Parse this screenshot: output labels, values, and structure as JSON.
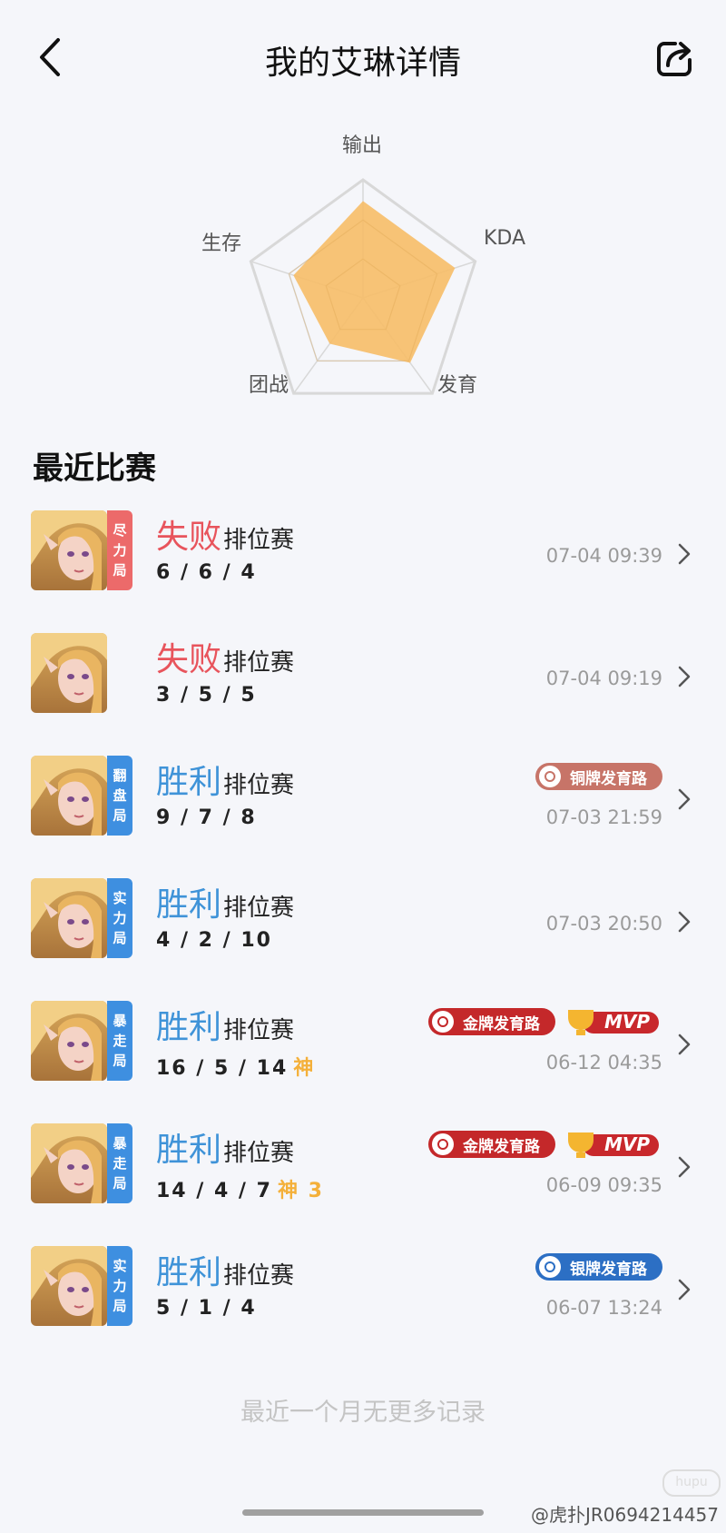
{
  "header": {
    "title": "我的艾琳详情"
  },
  "radar": {
    "labels": [
      "输出",
      "KDA",
      "发育",
      "团战",
      "生存"
    ],
    "values": [
      0.82,
      0.82,
      0.68,
      0.48,
      0.62
    ],
    "fill_color": "#f6be6a",
    "grid_color": "#d8d8d8"
  },
  "section_title": "最近比赛",
  "matches": [
    {
      "tag": "尽力局",
      "tag_color": "#ec6a6a",
      "result": "失败",
      "result_color": "#e8545c",
      "mode": "排位赛",
      "kda": "6 / 6 / 4",
      "extra": "",
      "time": "07-04 09:39",
      "badges": []
    },
    {
      "tag": "",
      "tag_color": "",
      "result": "失败",
      "result_color": "#e8545c",
      "mode": "排位赛",
      "kda": "3 / 5 / 5",
      "extra": "",
      "time": "07-04 09:19",
      "badges": []
    },
    {
      "tag": "翻盘局",
      "tag_color": "#3e8fe0",
      "result": "胜利",
      "result_color": "#3f93d8",
      "mode": "排位赛",
      "kda": "9 / 7 / 8",
      "extra": "",
      "time": "07-03 21:59",
      "badges": [
        "铜牌发育路"
      ]
    },
    {
      "tag": "实力局",
      "tag_color": "#3e8fe0",
      "result": "胜利",
      "result_color": "#3f93d8",
      "mode": "排位赛",
      "kda": "4 / 2 / 10",
      "extra": "",
      "time": "07-03 20:50",
      "badges": []
    },
    {
      "tag": "暴走局",
      "tag_color": "#3e8fe0",
      "result": "胜利",
      "result_color": "#3f93d8",
      "mode": "排位赛",
      "kda": "16 / 5 / 14",
      "extra": "神",
      "time": "06-12 04:35",
      "badges": [
        "金牌发育路",
        "MVP"
      ]
    },
    {
      "tag": "暴走局",
      "tag_color": "#3e8fe0",
      "result": "胜利",
      "result_color": "#3f93d8",
      "mode": "排位赛",
      "kda": "14 / 4 / 7",
      "extra": "神 3",
      "time": "06-09 09:35",
      "badges": [
        "金牌发育路",
        "MVP"
      ]
    },
    {
      "tag": "实力局",
      "tag_color": "#3e8fe0",
      "result": "胜利",
      "result_color": "#3f93d8",
      "mode": "排位赛",
      "kda": "5 / 1 / 4",
      "extra": "",
      "time": "06-07 13:24",
      "badges": [
        "银牌发育路"
      ]
    }
  ],
  "footer_note": "最近一个月无更多记录",
  "watermark": "@虎扑JR0694214457",
  "watermark_logo": "hupu",
  "icons": {
    "back": "chevron-left-icon",
    "share": "share-icon",
    "row": "chevron-right-icon"
  }
}
